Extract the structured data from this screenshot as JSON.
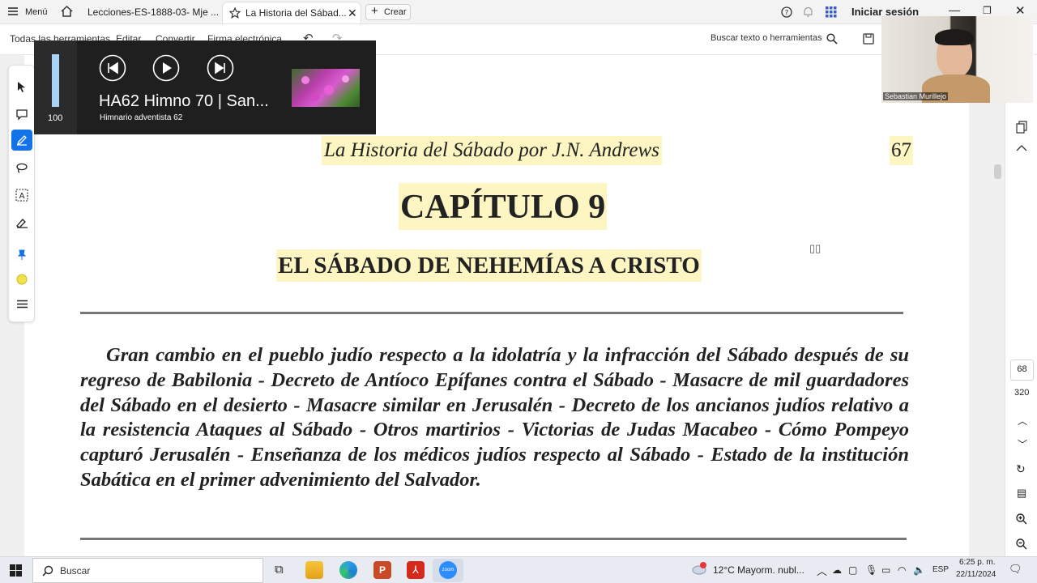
{
  "browser": {
    "menu_label": "Menú",
    "tabs": [
      {
        "label": "Lecciones-ES-1888-03- Mje ..."
      },
      {
        "label": "La Historia del Sábad..."
      }
    ],
    "new_tab_label": "Crear",
    "sign_in_label": "Iniciar sesión"
  },
  "toolbar": {
    "all_tools": "Todas las herramientas",
    "edit": "Editar",
    "convert": "Convertir",
    "e_signature": "Firma electrónica",
    "search_label": "Buscar texto o herramientas"
  },
  "media": {
    "volume": "100",
    "volume_level": 1.0,
    "title": "HA62 Himno 70 | San...",
    "subtitle": "Himnario adventista 62"
  },
  "webcam": {
    "name": "Sebastian Murillejo"
  },
  "document": {
    "running_head": "La Historia del Sábado por J.N. Andrews",
    "page_number": "67",
    "chapter": "CAPÍTULO 9",
    "chapter_subtitle": "EL SÁBADO DE NEHEMÍAS A CRISTO",
    "summary": "Gran cambio en el pueblo judío respecto a la idolatría y la infracción del Sábado después de su regreso de Babilonia - Decreto de Antíoco Epífanes contra el Sábado - Masacre de mil guardadores del Sábado en el desierto - Masacre similar en Jerusalén - Decreto de los ancianos judíos relativo a la resistencia Ataques al Sábado - Otros martirios - Victorias de Judas Macabeo - Cómo Pompeyo capturó Jerusalén - Enseñanza de los médicos judíos respecto al Sábado - Estado de la institución Sabática en el primer advenimiento del Salvador."
  },
  "pagenav": {
    "current": "68",
    "total": "320"
  },
  "taskbar": {
    "search_placeholder": "Buscar",
    "weather": "12°C  Mayorm. nubl...",
    "lang": "ESP",
    "time": "6:25 p. m.",
    "date": "22/11/2024",
    "app_badge": "zoom"
  },
  "colors": {
    "highlight": "#fdf6c3",
    "accent_blue": "#1473e6",
    "taskbar": "#e8ecf2"
  }
}
